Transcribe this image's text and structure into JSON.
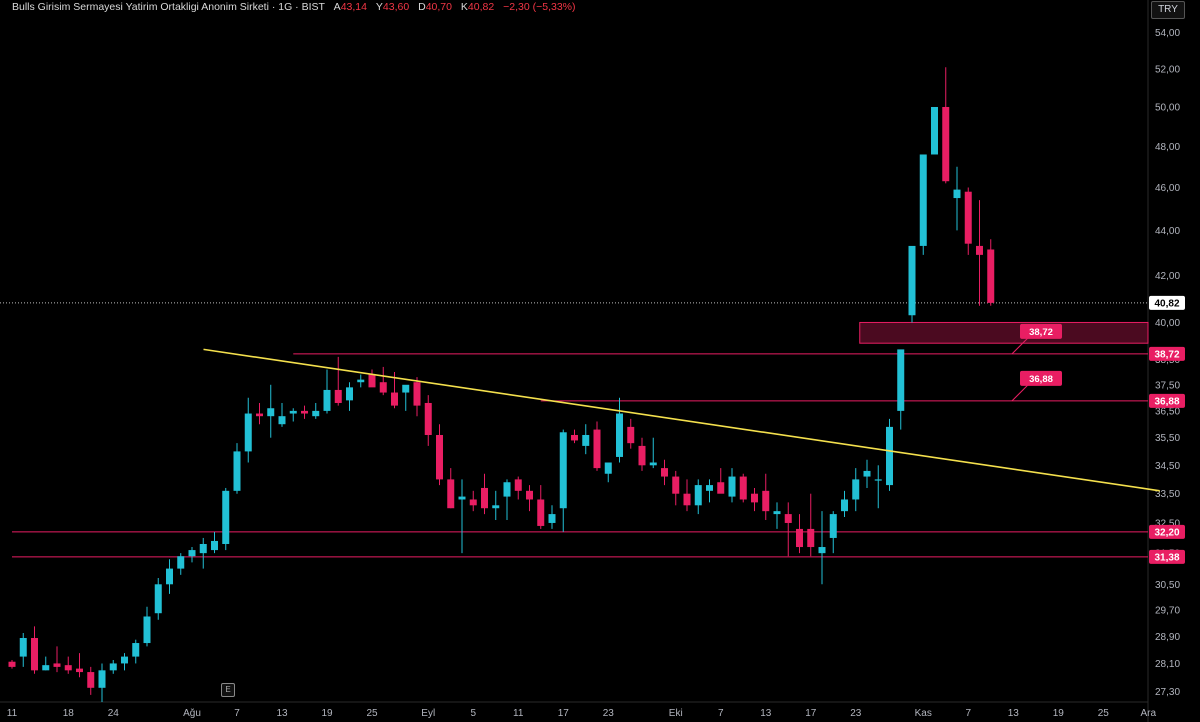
{
  "header": {
    "title": "Bulls Girisim Sermayesi Yatirim Ortakligi Anonim Sirketi · 1G · BIST",
    "open_label": "A",
    "open": "43,14",
    "high_label": "Y",
    "high": "43,60",
    "low_label": "D",
    "low": "40,70",
    "close_label": "K",
    "close": "40,82",
    "change": "−2,30 (−5,33%)"
  },
  "currency": "TRY",
  "e_marker": "E",
  "colors": {
    "up": "#22c1d6",
    "down": "#e91e63",
    "trend": "#f4e04d",
    "level": "#e91e63",
    "last_price": "#ffffff",
    "grid_text": "#b2b5be"
  },
  "chart_data": {
    "type": "candlestick",
    "y_scale": "log",
    "ylim": [
      27.0,
      54.6
    ],
    "y_ticks": [
      "27,30",
      "28,10",
      "28,90",
      "29,70",
      "30,50",
      "31,50",
      "32,50",
      "33,50",
      "34,50",
      "35,50",
      "36,50",
      "37,50",
      "38,50",
      "40,00",
      "42,00",
      "44,00",
      "46,00",
      "48,00",
      "50,00",
      "52,00",
      "54,00"
    ],
    "x_ticks": [
      {
        "i": 0,
        "label": "11"
      },
      {
        "i": 5,
        "label": "18"
      },
      {
        "i": 9,
        "label": "24"
      },
      {
        "i": 16,
        "label": "Ağu"
      },
      {
        "i": 20,
        "label": "7"
      },
      {
        "i": 24,
        "label": "13"
      },
      {
        "i": 28,
        "label": "19"
      },
      {
        "i": 32,
        "label": "25"
      },
      {
        "i": 37,
        "label": "Eyl"
      },
      {
        "i": 41,
        "label": "5"
      },
      {
        "i": 45,
        "label": "11"
      },
      {
        "i": 49,
        "label": "17"
      },
      {
        "i": 53,
        "label": "23"
      },
      {
        "i": 59,
        "label": "Eki"
      },
      {
        "i": 63,
        "label": "7"
      },
      {
        "i": 67,
        "label": "13"
      },
      {
        "i": 71,
        "label": "17"
      },
      {
        "i": 75,
        "label": "23"
      },
      {
        "i": 81,
        "label": "Kas"
      },
      {
        "i": 85,
        "label": "7"
      },
      {
        "i": 89,
        "label": "13"
      },
      {
        "i": 93,
        "label": "19"
      },
      {
        "i": 97,
        "label": "25"
      },
      {
        "i": 101,
        "label": "Ara"
      }
    ],
    "candles": [
      [
        28.15,
        28.2,
        27.95,
        28.0
      ],
      [
        28.3,
        29.0,
        28.0,
        28.85
      ],
      [
        28.85,
        29.2,
        27.8,
        27.9
      ],
      [
        27.9,
        28.3,
        27.9,
        28.05
      ],
      [
        28.1,
        28.6,
        27.85,
        28.0
      ],
      [
        28.05,
        28.3,
        27.8,
        27.9
      ],
      [
        27.95,
        28.4,
        27.7,
        27.85
      ],
      [
        27.85,
        28.0,
        27.2,
        27.4
      ],
      [
        27.4,
        28.1,
        27.0,
        27.9
      ],
      [
        27.9,
        28.2,
        27.8,
        28.1
      ],
      [
        28.1,
        28.4,
        27.9,
        28.3
      ],
      [
        28.3,
        28.8,
        28.1,
        28.7
      ],
      [
        28.7,
        29.8,
        28.6,
        29.5
      ],
      [
        29.6,
        30.7,
        29.4,
        30.5
      ],
      [
        30.5,
        31.3,
        30.2,
        31.0
      ],
      [
        31.0,
        31.5,
        30.8,
        31.4
      ],
      [
        31.4,
        31.7,
        31.2,
        31.6
      ],
      [
        31.5,
        32.0,
        31.0,
        31.8
      ],
      [
        31.6,
        32.2,
        31.5,
        31.9
      ],
      [
        31.8,
        33.7,
        31.6,
        33.6
      ],
      [
        33.6,
        35.3,
        33.5,
        35.0
      ],
      [
        35.0,
        37.0,
        34.6,
        36.4
      ],
      [
        36.4,
        36.8,
        36.0,
        36.3
      ],
      [
        36.3,
        37.5,
        35.5,
        36.6
      ],
      [
        36.0,
        36.8,
        35.9,
        36.3
      ],
      [
        36.4,
        36.6,
        36.1,
        36.5
      ],
      [
        36.5,
        36.7,
        36.2,
        36.4
      ],
      [
        36.3,
        36.8,
        36.2,
        36.5
      ],
      [
        36.5,
        38.1,
        36.4,
        37.3
      ],
      [
        37.3,
        38.6,
        36.7,
        36.8
      ],
      [
        36.9,
        37.6,
        36.5,
        37.4
      ],
      [
        37.6,
        37.9,
        37.4,
        37.7
      ],
      [
        37.9,
        38.1,
        37.5,
        37.4
      ],
      [
        37.6,
        38.2,
        37.1,
        37.2
      ],
      [
        37.2,
        38.0,
        36.6,
        36.7
      ],
      [
        37.2,
        37.4,
        36.5,
        37.5
      ],
      [
        37.6,
        37.8,
        36.3,
        36.7
      ],
      [
        36.8,
        37.1,
        35.2,
        35.6
      ],
      [
        35.6,
        36.0,
        33.8,
        34.0
      ],
      [
        34.0,
        34.4,
        33.0,
        33.0
      ],
      [
        33.3,
        34.0,
        31.5,
        33.4
      ],
      [
        33.3,
        33.6,
        32.9,
        33.1
      ],
      [
        33.7,
        34.2,
        32.8,
        33.0
      ],
      [
        33.0,
        33.6,
        32.6,
        33.1
      ],
      [
        33.4,
        34.0,
        32.6,
        33.9
      ],
      [
        34.0,
        34.1,
        33.3,
        33.6
      ],
      [
        33.6,
        33.8,
        32.9,
        33.3
      ],
      [
        33.3,
        33.8,
        32.3,
        32.4
      ],
      [
        32.5,
        33.1,
        32.3,
        32.8
      ],
      [
        33.0,
        35.8,
        32.2,
        35.7
      ],
      [
        35.6,
        35.8,
        35.3,
        35.4
      ],
      [
        35.2,
        36.0,
        34.9,
        35.6
      ],
      [
        35.8,
        36.1,
        34.3,
        34.4
      ],
      [
        34.2,
        34.6,
        33.9,
        34.6
      ],
      [
        34.8,
        37.0,
        34.6,
        36.4
      ],
      [
        35.9,
        36.2,
        35.1,
        35.3
      ],
      [
        35.2,
        35.5,
        34.3,
        34.5
      ],
      [
        34.5,
        35.5,
        34.4,
        34.6
      ],
      [
        34.4,
        34.7,
        33.8,
        34.1
      ],
      [
        34.1,
        34.3,
        33.1,
        33.5
      ],
      [
        33.5,
        34.0,
        32.9,
        33.1
      ],
      [
        33.1,
        34.0,
        32.8,
        33.8
      ],
      [
        33.6,
        34.0,
        33.2,
        33.8
      ],
      [
        33.9,
        34.4,
        33.6,
        33.5
      ],
      [
        33.4,
        34.4,
        33.2,
        34.1
      ],
      [
        34.1,
        34.2,
        33.2,
        33.3
      ],
      [
        33.5,
        33.7,
        32.9,
        33.2
      ],
      [
        33.6,
        34.2,
        32.6,
        32.9
      ],
      [
        32.8,
        33.2,
        32.3,
        32.9
      ],
      [
        32.8,
        33.2,
        31.4,
        32.5
      ],
      [
        32.3,
        32.8,
        31.5,
        31.7
      ],
      [
        32.3,
        33.5,
        31.4,
        31.7
      ],
      [
        31.5,
        32.9,
        30.5,
        31.7
      ],
      [
        32.0,
        32.9,
        31.5,
        32.8
      ],
      [
        32.9,
        33.6,
        32.7,
        33.3
      ],
      [
        33.3,
        34.4,
        32.9,
        34.0
      ],
      [
        34.1,
        34.7,
        33.7,
        34.3
      ],
      [
        34.0,
        34.5,
        33.0,
        34.0
      ],
      [
        33.8,
        36.2,
        33.6,
        35.9
      ],
      [
        36.5,
        38.2,
        35.8,
        38.9
      ],
      [
        40.3,
        40.6,
        40.0,
        43.3
      ],
      [
        43.3,
        44.8,
        42.9,
        47.6
      ],
      [
        47.6,
        49.6,
        48.8,
        50.0
      ],
      [
        50.0,
        52.1,
        46.2,
        46.3
      ],
      [
        45.5,
        47.0,
        44.0,
        45.9
      ],
      [
        45.8,
        46.0,
        42.9,
        43.4
      ],
      [
        43.3,
        45.4,
        40.7,
        42.9
      ],
      [
        43.14,
        43.6,
        40.7,
        40.82
      ]
    ],
    "trendline": {
      "from": [
        22,
        38.9
      ],
      "to": [
        107,
        33.6
      ],
      "label": ""
    },
    "levels": [
      {
        "price": 38.72,
        "label": "38,72",
        "tag": "38,72"
      },
      {
        "price": 36.88,
        "label": "36,88",
        "tag": "36,88"
      },
      {
        "price": 32.2,
        "label": "32,20"
      },
      {
        "price": 31.38,
        "label": "31,38"
      }
    ],
    "zone": {
      "top": 40.0,
      "bottom": 39.15
    },
    "last_price": {
      "value": 40.82,
      "label": "40,82"
    }
  }
}
